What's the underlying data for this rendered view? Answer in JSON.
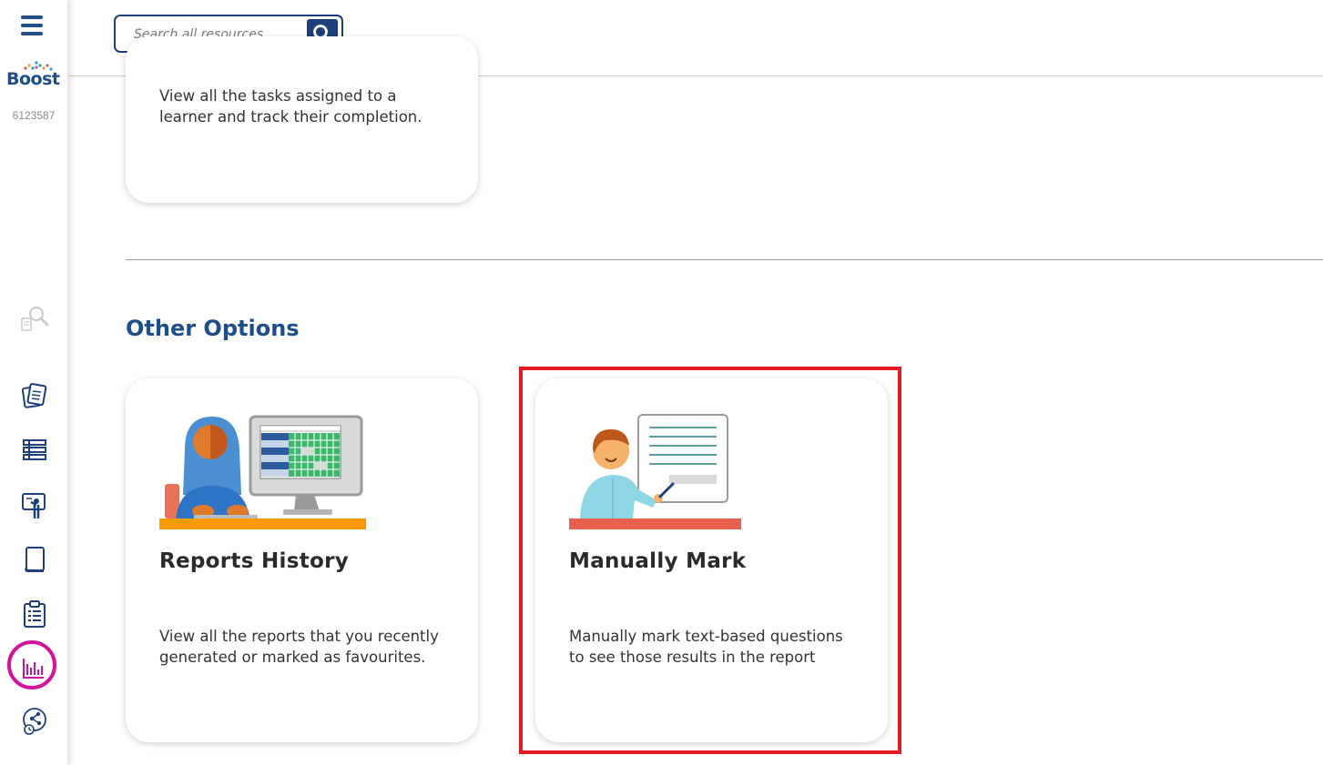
{
  "sidebar": {
    "logo_text": "Boost",
    "school_id": "6123587",
    "icons": [
      "menu-icon",
      "search-resources-icon",
      "documents-icon",
      "list-icon",
      "teacher-icon",
      "book-icon",
      "clipboard-icon",
      "reports-chart-icon",
      "share-history-icon"
    ],
    "active_color": "#d4139c"
  },
  "header": {
    "search_placeholder": "Search all resources"
  },
  "top_card": {
    "description": "View all the tasks assigned to a learner and track their completion."
  },
  "other_options": {
    "title": "Other Options",
    "cards": [
      {
        "title": "Reports History",
        "description": "View all the reports that you recently generated or marked as favourites."
      },
      {
        "title": "Manually Mark",
        "description": "Manually mark text-based questions to see those results in the report"
      }
    ]
  },
  "colors": {
    "brand_blue": "#1d4e8c",
    "highlight_red": "#e11b22"
  }
}
